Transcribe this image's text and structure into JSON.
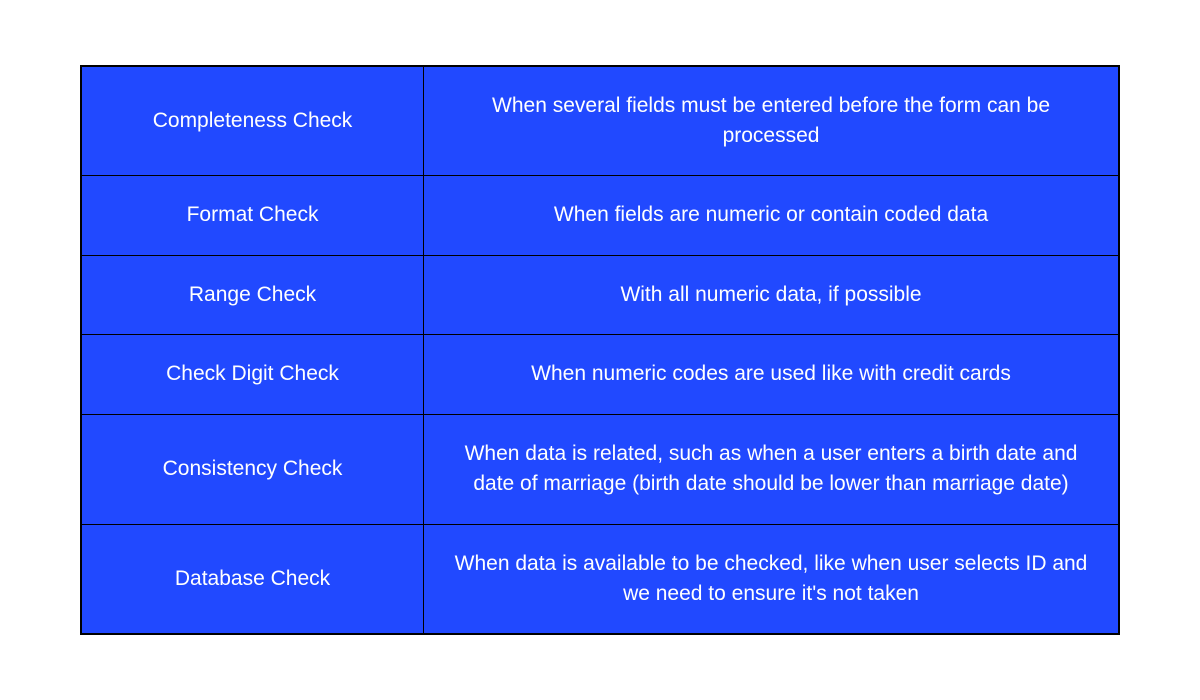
{
  "table": {
    "rows": [
      {
        "name": "Completeness Check",
        "desc": "When several fields must be entered before the form can be processed"
      },
      {
        "name": "Format Check",
        "desc": "When fields are numeric or contain coded data"
      },
      {
        "name": "Range Check",
        "desc": "With all numeric data, if possible"
      },
      {
        "name": "Check Digit Check",
        "desc": "When numeric codes are used like with credit cards"
      },
      {
        "name": "Consistency Check",
        "desc": "When data is related, such as when a user enters a birth date and date of marriage (birth date should be lower than marriage date)"
      },
      {
        "name": "Database Check",
        "desc": "When data is available to be checked, like when user selects ID and we need to ensure it's not taken"
      }
    ]
  }
}
